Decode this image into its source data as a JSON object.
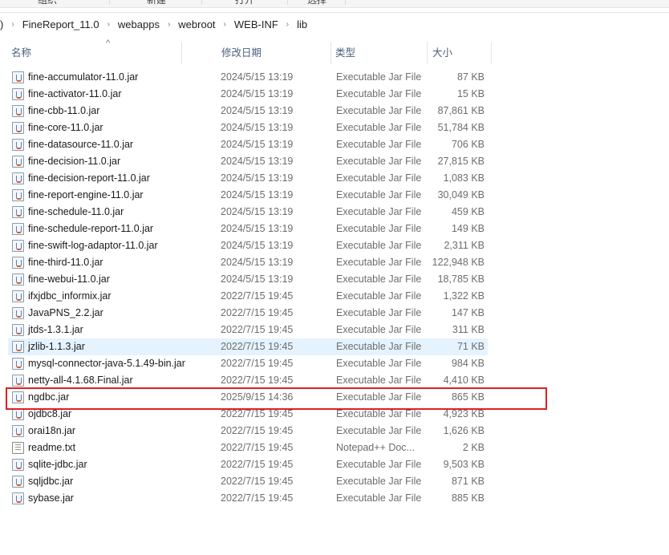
{
  "toolbar": {
    "items": [
      "组织",
      "新建",
      "打开",
      "选择"
    ]
  },
  "breadcrumb": {
    "lead": ")",
    "items": [
      "FineReport_11.0",
      "webapps",
      "webroot",
      "WEB-INF",
      "lib"
    ]
  },
  "columns": {
    "name": "名称",
    "date": "修改日期",
    "type": "类型",
    "size": "大小"
  },
  "highlight_color": "#e02020",
  "files": [
    {
      "name": "fine-accumulator-11.0.jar",
      "date": "2024/5/15 13:19",
      "type": "Executable Jar File",
      "size": "87 KB",
      "icon": "jar-icon"
    },
    {
      "name": "fine-activator-11.0.jar",
      "date": "2024/5/15 13:19",
      "type": "Executable Jar File",
      "size": "15 KB",
      "icon": "jar-icon"
    },
    {
      "name": "fine-cbb-11.0.jar",
      "date": "2024/5/15 13:19",
      "type": "Executable Jar File",
      "size": "87,861 KB",
      "icon": "jar-icon"
    },
    {
      "name": "fine-core-11.0.jar",
      "date": "2024/5/15 13:19",
      "type": "Executable Jar File",
      "size": "51,784 KB",
      "icon": "jar-icon"
    },
    {
      "name": "fine-datasource-11.0.jar",
      "date": "2024/5/15 13:19",
      "type": "Executable Jar File",
      "size": "706 KB",
      "icon": "jar-icon"
    },
    {
      "name": "fine-decision-11.0.jar",
      "date": "2024/5/15 13:19",
      "type": "Executable Jar File",
      "size": "27,815 KB",
      "icon": "jar-icon"
    },
    {
      "name": "fine-decision-report-11.0.jar",
      "date": "2024/5/15 13:19",
      "type": "Executable Jar File",
      "size": "1,083 KB",
      "icon": "jar-icon"
    },
    {
      "name": "fine-report-engine-11.0.jar",
      "date": "2024/5/15 13:19",
      "type": "Executable Jar File",
      "size": "30,049 KB",
      "icon": "jar-icon"
    },
    {
      "name": "fine-schedule-11.0.jar",
      "date": "2024/5/15 13:19",
      "type": "Executable Jar File",
      "size": "459 KB",
      "icon": "jar-icon"
    },
    {
      "name": "fine-schedule-report-11.0.jar",
      "date": "2024/5/15 13:19",
      "type": "Executable Jar File",
      "size": "149 KB",
      "icon": "jar-icon"
    },
    {
      "name": "fine-swift-log-adaptor-11.0.jar",
      "date": "2024/5/15 13:19",
      "type": "Executable Jar File",
      "size": "2,311 KB",
      "icon": "jar-icon"
    },
    {
      "name": "fine-third-11.0.jar",
      "date": "2024/5/15 13:19",
      "type": "Executable Jar File",
      "size": "122,948 KB",
      "icon": "jar-icon"
    },
    {
      "name": "fine-webui-11.0.jar",
      "date": "2024/5/15 13:19",
      "type": "Executable Jar File",
      "size": "18,785 KB",
      "icon": "jar-icon"
    },
    {
      "name": "ifxjdbc_informix.jar",
      "date": "2022/7/15 19:45",
      "type": "Executable Jar File",
      "size": "1,322 KB",
      "icon": "jar-icon"
    },
    {
      "name": "JavaPNS_2.2.jar",
      "date": "2022/7/15 19:45",
      "type": "Executable Jar File",
      "size": "147 KB",
      "icon": "jar-icon"
    },
    {
      "name": "jtds-1.3.1.jar",
      "date": "2022/7/15 19:45",
      "type": "Executable Jar File",
      "size": "311 KB",
      "icon": "jar-icon"
    },
    {
      "name": "jzlib-1.1.3.jar",
      "date": "2022/7/15 19:45",
      "type": "Executable Jar File",
      "size": "71 KB",
      "icon": "jar-icon",
      "selected": true
    },
    {
      "name": "mysql-connector-java-5.1.49-bin.jar",
      "date": "2022/7/15 19:45",
      "type": "Executable Jar File",
      "size": "984 KB",
      "icon": "jar-icon"
    },
    {
      "name": "netty-all-4.1.68.Final.jar",
      "date": "2022/7/15 19:45",
      "type": "Executable Jar File",
      "size": "4,410 KB",
      "icon": "jar-icon"
    },
    {
      "name": "ngdbc.jar",
      "date": "2025/9/15 14:36",
      "type": "Executable Jar File",
      "size": "865 KB",
      "icon": "jar-icon",
      "highlighted": true
    },
    {
      "name": "ojdbc8.jar",
      "date": "2022/7/15 19:45",
      "type": "Executable Jar File",
      "size": "4,923 KB",
      "icon": "jar-icon"
    },
    {
      "name": "orai18n.jar",
      "date": "2022/7/15 19:45",
      "type": "Executable Jar File",
      "size": "1,626 KB",
      "icon": "jar-icon"
    },
    {
      "name": "readme.txt",
      "date": "2022/7/15 19:45",
      "type": "Notepad++ Doc...",
      "size": "2 KB",
      "icon": "text-file-icon"
    },
    {
      "name": "sqlite-jdbc.jar",
      "date": "2022/7/15 19:45",
      "type": "Executable Jar File",
      "size": "9,503 KB",
      "icon": "jar-icon"
    },
    {
      "name": "sqljdbc.jar",
      "date": "2022/7/15 19:45",
      "type": "Executable Jar File",
      "size": "871 KB",
      "icon": "jar-icon"
    },
    {
      "name": "sybase.jar",
      "date": "2022/7/15 19:45",
      "type": "Executable Jar File",
      "size": "885 KB",
      "icon": "jar-icon"
    }
  ]
}
